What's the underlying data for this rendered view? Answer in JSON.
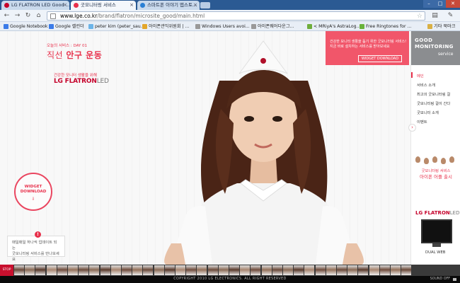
{
  "browser": {
    "tabs": [
      {
        "title": "LG FLATRON LED Good ...",
        "active": false
      },
      {
        "title": "굿모니터링 서비스",
        "active": true
      },
      {
        "title": "스마트폰 이야기 앱스토...",
        "active": false
      }
    ],
    "url_host": "www.lge.co.kr",
    "url_path": "/brand/flatron/microsite_good/main.html",
    "bookmarks": [
      "Google Notebook",
      "Google 캘린더",
      "peter kim (peter_sau...",
      "아이폰관익위원회 | ...",
      "Windows Users avoi...",
      "아이폰웨어다운그...",
      "< MRiyA's AstraLog...",
      "Free Ringtones for ...",
      "기타 북마크"
    ]
  },
  "page": {
    "day_label": "오늘의 서비스 : DAY 01",
    "title_prefix": "직선",
    "title_bold": "안구 운동",
    "healthy_label": "건강한 모니터 생활을 위해",
    "logo_lg": "LG",
    "logo_flatron": "FLATRON",
    "logo_led": "LED",
    "widget_circle_line1": "WIDGET",
    "widget_circle_line2": "DOWNLOAD",
    "widget_circle_icon": "download-icon",
    "notice_line1": "매일매일 하나씩 업데이트 되는",
    "notice_line2": "굿모니터링 서비스를 만나보세요",
    "notice_badge": "!",
    "banner_line1": "건강한 모니터 생활을 돕기 위한 굿모니터링 서비스!",
    "banner_line2": "지금 바로 설치하는 서비스를 받아보세요",
    "banner_button": "WIDGET DOWNLOAD",
    "sidebar_logo_good": "GOOD",
    "sidebar_logo_monitoring": "MONITORING",
    "sidebar_logo_service": "service",
    "menu": [
      "메인",
      "서비스 소개",
      "최고의 굿모니터링 걸",
      "굿모니터링 걸이 간다",
      "굿모니터 소개",
      "이벤트"
    ],
    "promo_line1": "굿모니터링 서비스",
    "promo_line2": "아이폰 어플 출시",
    "side_logo_lg": "LG",
    "side_logo_flatron": "FLATRON",
    "side_logo_led": "LED",
    "dual_web": "DUAL WEB",
    "stop_button": "STOP",
    "copyright": "COPYRIGHT 2010 LG ELECTRONICS. ALL RIGHT RESERVED",
    "sound_off": "SOUND OFF"
  },
  "colors": {
    "accent": "#e8304b",
    "banner": "#f1566a",
    "sidebar_logo": "#8b8d90",
    "tab_bar": "#2b5a93"
  }
}
